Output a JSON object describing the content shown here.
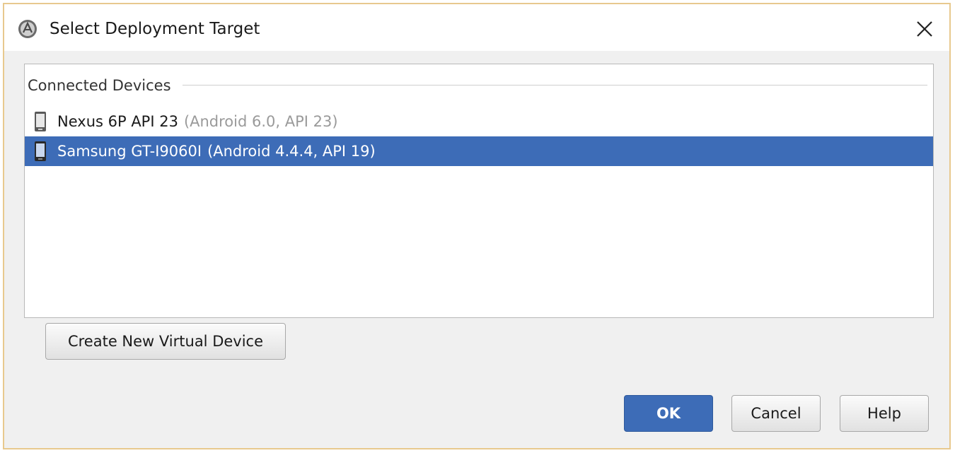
{
  "window": {
    "title": "Select Deployment Target",
    "icon": "android-studio-icon"
  },
  "connected_devices": {
    "header": "Connected Devices",
    "items": [
      {
        "name": "Nexus 6P API 23",
        "meta": "(Android 6.0, API 23)",
        "selected": false,
        "icon": "phone-icon"
      },
      {
        "name": "Samsung GT-I9060I",
        "meta": "(Android 4.4.4, API 19)",
        "selected": true,
        "icon": "phone-icon"
      }
    ]
  },
  "buttons": {
    "create_virtual_device": "Create New Virtual Device",
    "ok": "OK",
    "cancel": "Cancel",
    "help": "Help"
  },
  "colors": {
    "selection": "#3d6cb7",
    "window_border": "#e8c98e",
    "secondary_text": "#9a9a9a"
  }
}
